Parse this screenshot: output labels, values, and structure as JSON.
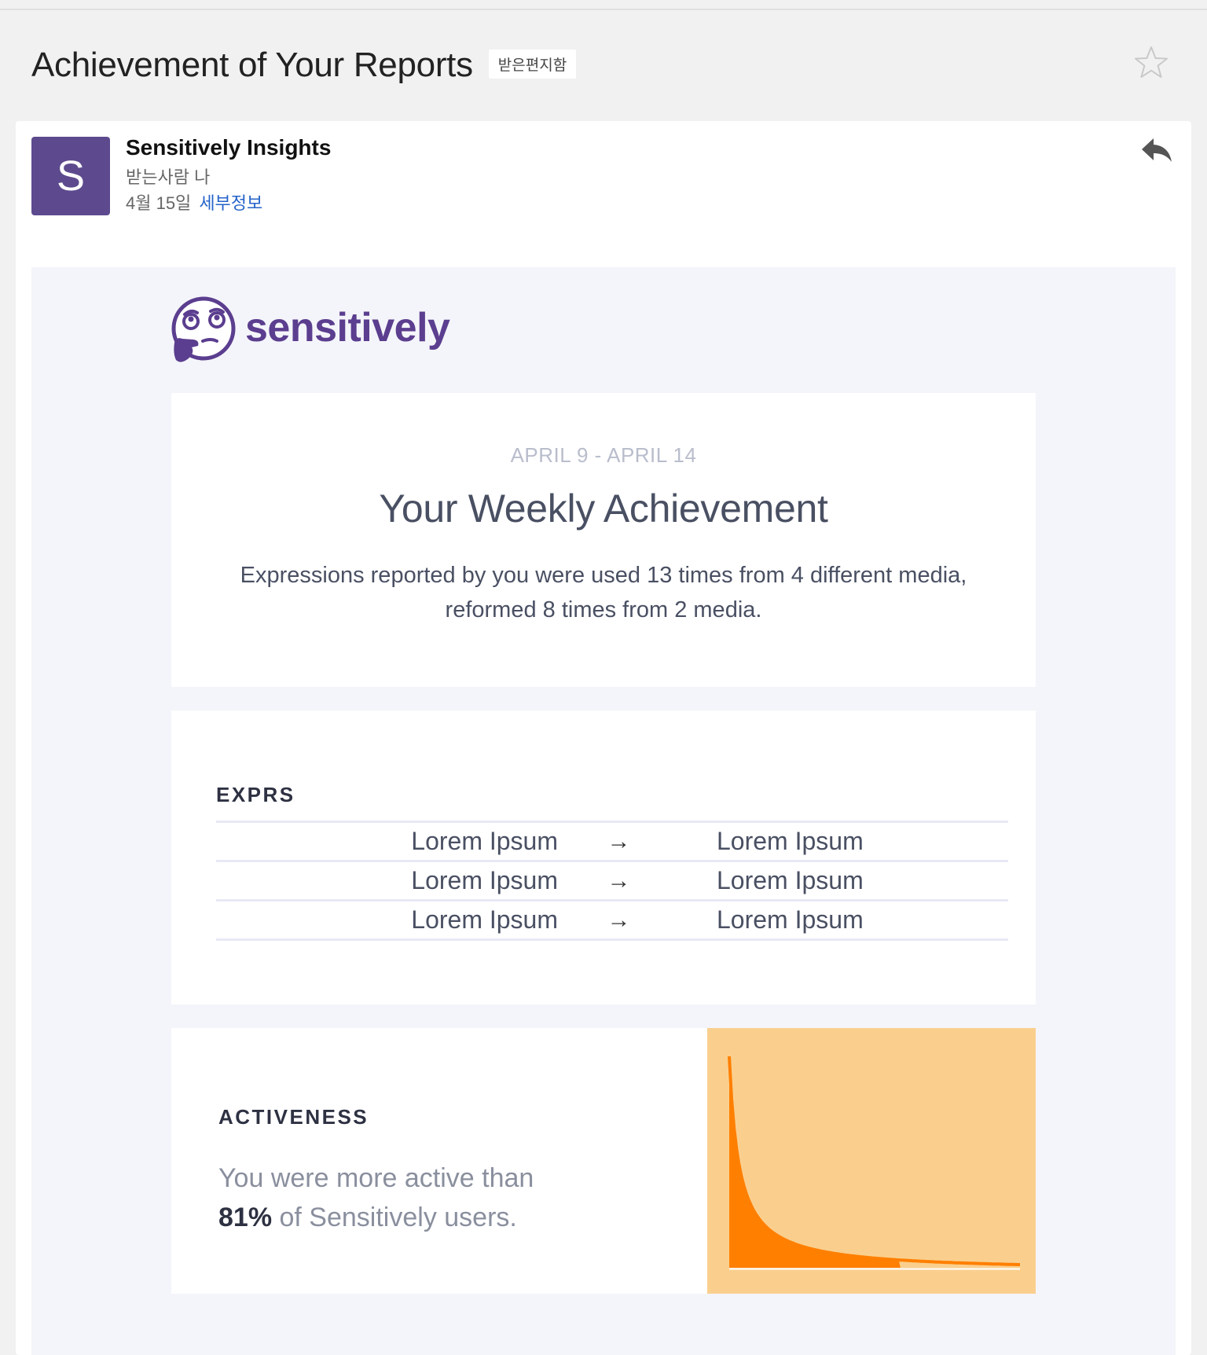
{
  "email": {
    "subject": "Achievement of Your Reports",
    "folder_label": "받은편지함",
    "star_icon": "star-outline-icon",
    "sender": {
      "avatar_letter": "S",
      "avatar_color": "#5d4a8e",
      "name": "Sensitively Insights",
      "recipient": "받는사람 나",
      "date": "4월 15일",
      "details_link": "세부정보"
    },
    "reply_icon": "reply-icon"
  },
  "newsletter": {
    "brand": {
      "logo_icon": "thinking-face-icon",
      "name": "sensitively",
      "color": "#5b3e8f"
    },
    "weekly": {
      "date_range": "APRIL 9 - APRIL 14",
      "title": "Your Weekly Achievement",
      "summary_line1": "Expressions reported by you were used 13 times from 4 different media,",
      "summary_line2": "reformed 8 times from 2 media."
    },
    "exprs": {
      "title": "EXPRS",
      "arrow": "→",
      "rows": [
        {
          "from": "Lorem Ipsum",
          "to": "Lorem Ipsum"
        },
        {
          "from": "Lorem Ipsum",
          "to": "Lorem Ipsum"
        },
        {
          "from": "Lorem Ipsum",
          "to": "Lorem Ipsum"
        }
      ]
    },
    "activeness": {
      "title": "ACTIVENESS",
      "text_line1": "You were more active than",
      "percent": "81%",
      "text_line2": " of Sensitively users.",
      "chart_bg_color": "#facf8e",
      "chart_fill_color": "#ff7f00",
      "percentile": 0.81
    }
  }
}
